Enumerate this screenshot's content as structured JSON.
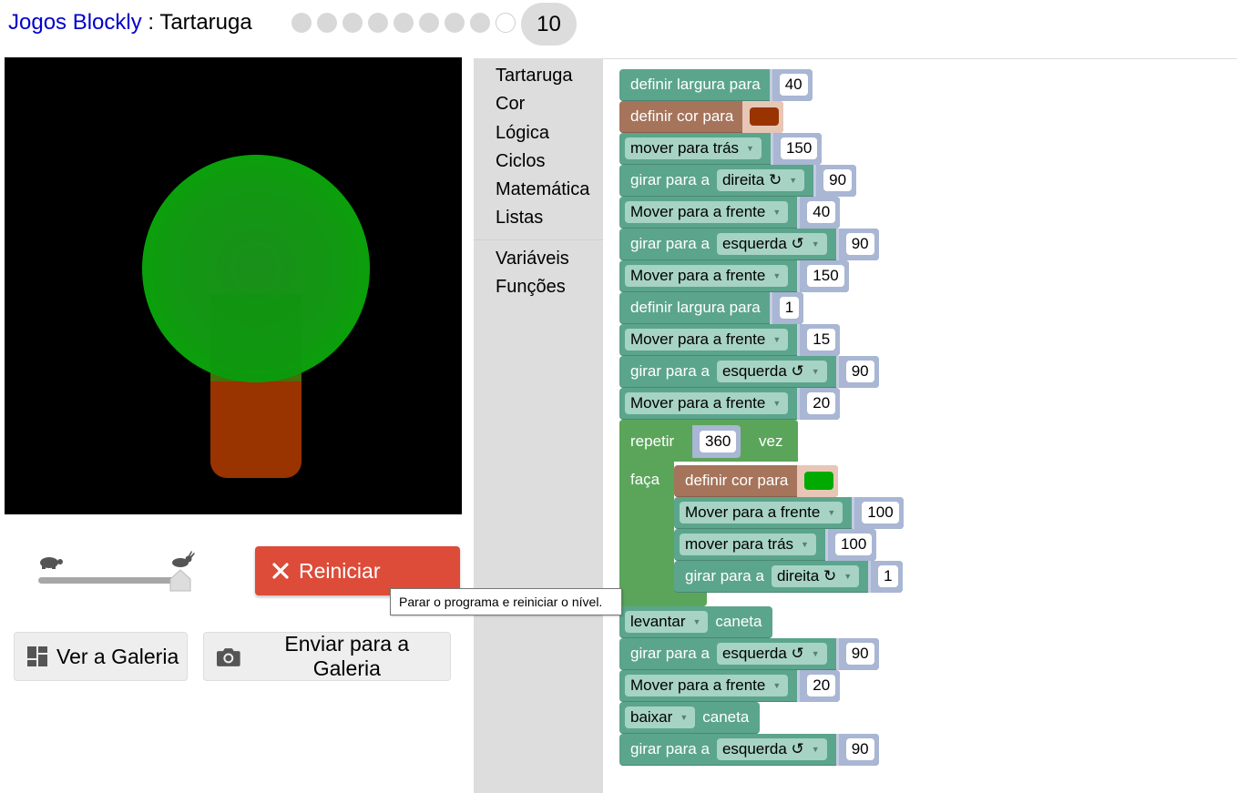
{
  "header": {
    "app_link": "Jogos Blockly",
    "separator": " : ",
    "page_title": "Tartaruga",
    "level_current": "10",
    "levels_total": 10
  },
  "controls": {
    "reset_label": "Reiniciar",
    "gallery_label": "Ver a Galeria",
    "submit_label": "Enviar para a Galeria",
    "reset_tooltip": "Parar o programa e reiniciar o nível.",
    "speed_fraction": 1.0
  },
  "toolbox": {
    "categories": [
      "Tartaruga",
      "Cor",
      "Lógica",
      "Ciclos",
      "Matemática",
      "Listas"
    ],
    "extra": [
      "Variáveis",
      "Funções"
    ]
  },
  "colors": {
    "turtle_block": "#5ba58c",
    "color_block": "#a5745b",
    "loop_block": "#5ba55b",
    "trunk": "#993300",
    "crown": "#00aa00",
    "reset_button": "#dd4b39"
  },
  "blocks": [
    {
      "text": "definir largura para",
      "value": "40"
    },
    {
      "text": "definir cor para",
      "color": "#993300"
    },
    {
      "dropdown": "mover para trás",
      "value": "150"
    },
    {
      "text": "girar para a",
      "dropdown": "direita ↻",
      "value": "90"
    },
    {
      "dropdown": "Mover para a frente",
      "value": "40"
    },
    {
      "text": "girar para a",
      "dropdown": "esquerda ↺",
      "value": "90"
    },
    {
      "dropdown": "Mover para a frente",
      "value": "150"
    },
    {
      "text": "definir largura para",
      "value": "1"
    },
    {
      "dropdown": "Mover para a frente",
      "value": "15"
    },
    {
      "text": "girar para a",
      "dropdown": "esquerda ↺",
      "value": "90"
    },
    {
      "dropdown": "Mover para a frente",
      "value": "20"
    },
    {
      "repeat_label": "repetir",
      "times": "360",
      "times_label": "vez",
      "do_label": "faça"
    },
    {
      "text": "definir cor para",
      "color": "#00aa00"
    },
    {
      "dropdown": "Mover para a frente",
      "value": "100"
    },
    {
      "dropdown": "mover para trás",
      "value": "100"
    },
    {
      "text": "girar para a",
      "dropdown": "direita ↻",
      "value": "1"
    },
    {
      "dropdown": "levantar",
      "text": "caneta"
    },
    {
      "text": "girar para a",
      "dropdown": "esquerda ↺",
      "value": "90"
    },
    {
      "dropdown": "Mover para a frente",
      "value": "20"
    },
    {
      "dropdown": "baixar",
      "text": "caneta"
    },
    {
      "text": "girar para a",
      "dropdown": "esquerda ↺",
      "value": "90"
    }
  ]
}
